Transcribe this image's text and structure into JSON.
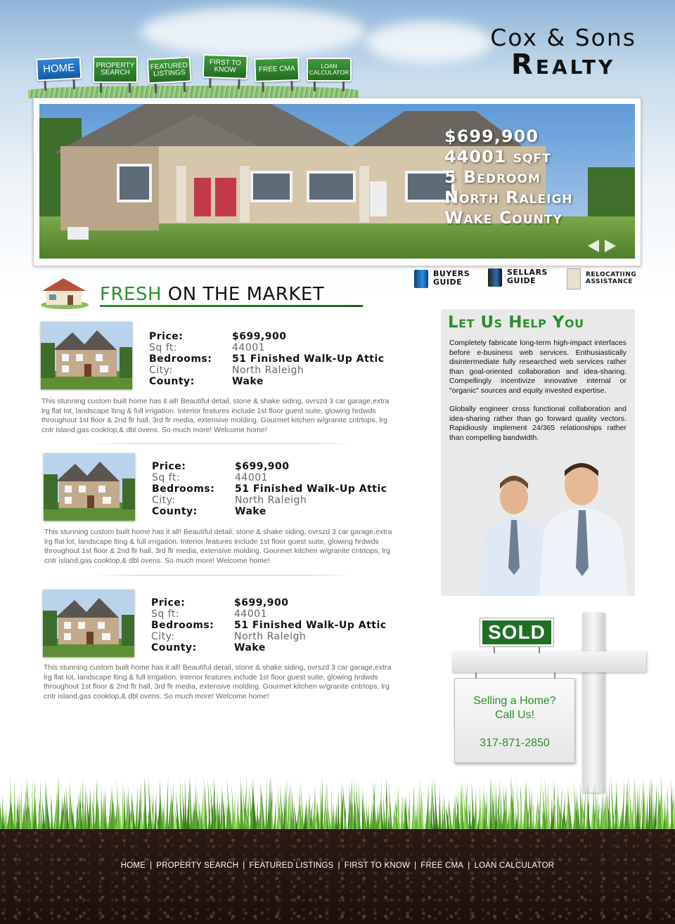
{
  "brand": {
    "line1": "Cox & Sons",
    "line2": "Realty"
  },
  "nav": [
    {
      "label": "Home"
    },
    {
      "label": "Property Search"
    },
    {
      "label": "Featured Listings"
    },
    {
      "label": "First to Know"
    },
    {
      "label": "Free CMA"
    },
    {
      "label": "Loan Calculator"
    }
  ],
  "hero": {
    "price": "$699,900",
    "sqft": "44001 sqft",
    "bedrooms": "5 Bedroom",
    "city": "North Raleigh",
    "county": "Wake County"
  },
  "guides": [
    {
      "line1": "Buyers",
      "line2": "Guide",
      "icon": "buyers-guide-icon"
    },
    {
      "line1": "Sellars",
      "line2": "Guide",
      "icon": "sellars-guide-icon"
    },
    {
      "line1": "Relocatiing",
      "line2": "Assistance",
      "icon": "relocation-map-icon"
    }
  ],
  "fresh": {
    "highlight": "FRESH",
    "rest": "ON THE MARKET"
  },
  "listing_labels": {
    "price": "Price:",
    "sqft": "Sq ft:",
    "bedrooms": "Bedrooms:",
    "city": "City:",
    "county": "County:"
  },
  "listings": [
    {
      "price": "$699,900",
      "sqft": "44001",
      "bedrooms": "51 Finished Walk-Up Attic",
      "city": "North Raleigh",
      "county": "Wake",
      "description": "This stunning custom built home has it all! Beautiful detail, stone & shake siding, ovrszd 3 car garage,extra lrg flat lot, landscape lting & full irrigation. Interior features include 1st floor guest suite, glowing hrdwds throughout 1st floor & 2nd flr hall, 3rd flr media, extensive molding. Gourmet kitchen w/granite cntrtops, lrg cntr island,gas cooktop,& dbl ovens. So much more! Welcome home!"
    },
    {
      "price": "$699,900",
      "sqft": "44001",
      "bedrooms": "51 Finished Walk-Up Attic",
      "city": "North Raleigh",
      "county": "Wake",
      "description": "This stunning custom built home has it all! Beautiful detail, stone & shake siding, ovrszd 3 car garage,extra lrg flat lot, landscape lting & full irrigation. Interior features include 1st floor guest suite, glowing hrdwds throughout 1st floor & 2nd flr hall, 3rd flr media, extensive molding. Gourmet kitchen w/granite cntrtops, lrg cntr island,gas cooktop,& dbl ovens. So much more! Welcome home!"
    },
    {
      "price": "$699,900",
      "sqft": "44001",
      "bedrooms": "51 Finished Walk-Up Attic",
      "city": "North Raleigh",
      "county": "Wake",
      "description": "This stunning custom built home has it all! Beautiful detail, stone & shake siding, ovrszd 3 car garage,extra lrg flat lot, landscape lting & full irrigation. Interior features include 1st floor guest suite, glowing hrdwds throughout 1st floor & 2nd flr hall, 3rd flr media, extensive molding. Gourmet kitchen w/granite cntrtops, lrg cntr island,gas cooktop,& dbl ovens. So much more! Welcome home!"
    }
  ],
  "help": {
    "title": "Let Us Help You",
    "p1": "Completely fabricate long-term high-impact interfaces before e-business web services. Enthusiastically disintermediate fully researched web services rather than goal-oriented collaboration and idea-sharing. Compellingly incentivize innovative internal or \"organic\" sources and equity invested expertise.",
    "p2": "Globally engineer cross functional collaboration and idea-sharing rather than go forward quality vectors. Rapidiously implement 24/365 relationships rather than compelling bandwidth."
  },
  "sold": {
    "badge": "SOLD",
    "line1": "Selling a Home?",
    "line2": "Call Us!",
    "phone": "317-871-2850"
  },
  "footer": [
    "HOME",
    "PROPERTY SEARCH",
    "FEATURED LISTINGS",
    "FIRST TO KNOW",
    "FREE CMA",
    "LOAN CALCULATOR"
  ],
  "colors": {
    "green": "#2c8f2c",
    "nav_green": "#21701f",
    "nav_blue": "#1459a8",
    "sold_green": "#1f6f25"
  }
}
